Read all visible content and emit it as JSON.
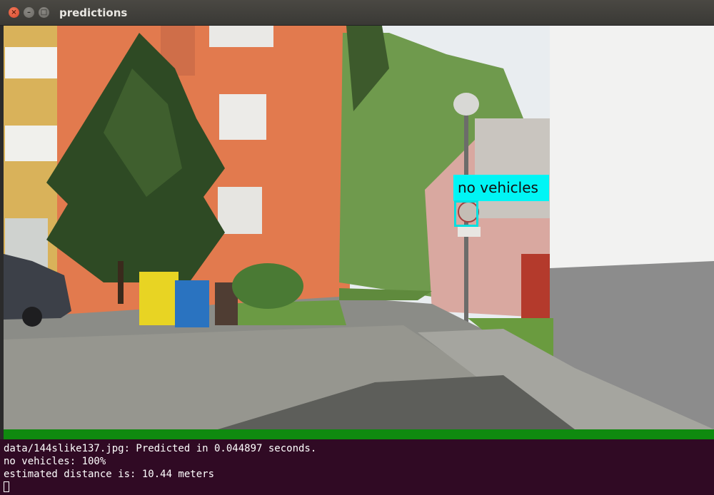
{
  "window": {
    "title": "predictions",
    "close_glyph": "×",
    "min_glyph": "–",
    "max_glyph": "□"
  },
  "detection": {
    "label": "no vehicles",
    "box_color": "#00f5f5"
  },
  "terminal": {
    "lines": [
      "data/144slike137.jpg: Predicted in 0.044897 seconds.",
      "no vehicles: 100%",
      "estimated distance is: 10.44 meters"
    ],
    "background": "#300a24"
  },
  "colors": {
    "progress_bar": "#0f8a0f",
    "close_button": "#e2553a"
  }
}
